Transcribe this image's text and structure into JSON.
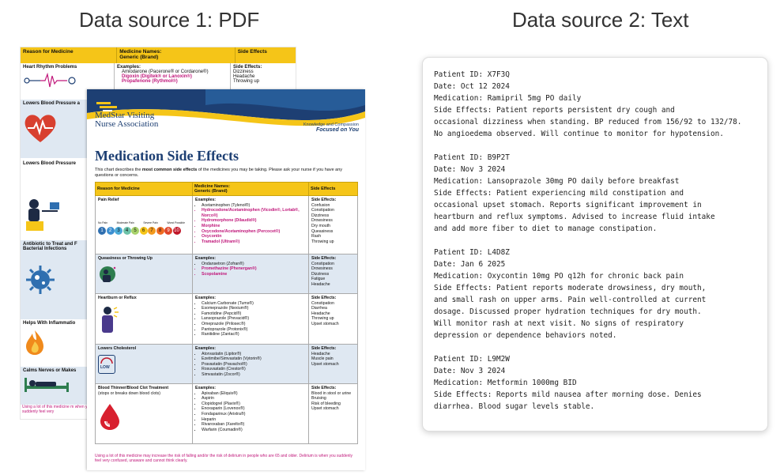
{
  "headings": {
    "left": "Data source 1: PDF",
    "right": "Data source 2: Text"
  },
  "pdf_back": {
    "header": [
      "Reason for Medicine",
      "Medicine Names:\nGeneric (Brand)",
      "Side Effects"
    ],
    "row1": {
      "reason": "Heart Rhythm Problems",
      "examples_label": "Examples:",
      "meds": [
        "Amiodarone (Pacerone® or Cordarone®)",
        "Digoxin (Digitek® or Lanoxin®)",
        "Propafenone (Rythmol®)"
      ],
      "side_label": "Side Effects:",
      "sides": [
        "Dizziness",
        "Headache",
        "Throwing up"
      ]
    },
    "left_labels": [
      "Lowers Blood Pressure a",
      "Lowers Blood Pressure",
      "Antibiotic to Treat and F Bacterial Infections",
      "Helps With Inflammatio",
      "Calms Nerves or Makes"
    ],
    "footnote": "Using a lot of this medicine m when you suddenly feel very"
  },
  "pdf_front": {
    "org_line1": "MedStar Visiting",
    "org_line2": "Nurse Association",
    "tagline": "Knowledge and Compassion",
    "tagline_bold": "Focused on You",
    "title": "Medication Side Effects",
    "intro_a": "This chart describes the ",
    "intro_b": "most common side effects",
    "intro_c": " of the medicines you may be taking. Please ask your nurse if you have any questions or concerns.",
    "header": [
      "Reason for Medicine",
      "Medicine Names:\nGeneric (Brand)",
      "Side Effects"
    ],
    "pain_scale_labels": [
      "No Pain",
      "Moderate Pain",
      "Severe Pain",
      "Worst Possible"
    ],
    "pain_scale_numbers": [
      "1",
      "2",
      "3",
      "4",
      "5",
      "6",
      "7",
      "8",
      "9",
      "10"
    ],
    "rows": [
      {
        "reason": "Pain Relief",
        "meds": [
          {
            "t": "Acetaminophen (Tylenol®)",
            "p": false
          },
          {
            "t": "Hydrocodone/Acetaminophen (Vicodin®, Lortab®, Norco®)",
            "p": true
          },
          {
            "t": "Hydromorphone (Dilaudid®)",
            "p": true
          },
          {
            "t": "Morphine",
            "p": true
          },
          {
            "t": "Oxycodone/Acetaminophen (Percocet®)",
            "p": true
          },
          {
            "t": "Oxycontin",
            "p": true
          },
          {
            "t": "Tramadol (Ultram®)",
            "p": true
          }
        ],
        "sides": [
          "Confusion",
          "Constipation",
          "Dizziness",
          "Drowsiness",
          "Dry mouth",
          "Queasiness",
          "Rash",
          "Throwing up"
        ]
      },
      {
        "reason": "Queasiness or Throwing Up",
        "meds": [
          {
            "t": "Ondansetron (Zofran®)",
            "p": false
          },
          {
            "t": "Promethazine (Phenergan®)",
            "p": true
          },
          {
            "t": "Scopolamine",
            "p": true
          }
        ],
        "sides": [
          "Constipation",
          "Drowsiness",
          "Dizziness",
          "Fatigue",
          "Headache"
        ]
      },
      {
        "reason": "Heartburn or Reflux",
        "meds": [
          {
            "t": "Calcium Carbonate (Tums®)",
            "p": false
          },
          {
            "t": "Esomeprazole (Nexium®)",
            "p": false
          },
          {
            "t": "Famotidine (Pepcid®)",
            "p": false
          },
          {
            "t": "Lansoprazole (Prevacid®)",
            "p": false
          },
          {
            "t": "Omeprazole (Prilosec®)",
            "p": false
          },
          {
            "t": "Pantoprazole (Protonix®)",
            "p": false
          },
          {
            "t": "Ranitidine (Zantac®)",
            "p": false
          }
        ],
        "sides": [
          "Constipation",
          "Diarrhea",
          "Headache",
          "Throwing up",
          "Upset stomach"
        ]
      },
      {
        "reason": "Lowers Cholesterol",
        "meds": [
          {
            "t": "Atorvastatin (Lipitor®)",
            "p": false
          },
          {
            "t": "Ezetimibe/Simvastatin (Vytorin®)",
            "p": false
          },
          {
            "t": "Pravastatin (Pravachol®)",
            "p": false
          },
          {
            "t": "Rosuvastatin (Crestor®)",
            "p": false
          },
          {
            "t": "Simvastatin (Zocor®)",
            "p": false
          }
        ],
        "sides": [
          "Headache",
          "Muscle pain",
          "Upset stomach"
        ]
      },
      {
        "reason": "Blood Thinner/Blood Clot Treatment",
        "reason_sub": "(stops or breaks down blood clots)",
        "meds": [
          {
            "t": "Apixaban (Eliquis®)",
            "p": false
          },
          {
            "t": "Aspirin",
            "p": false
          },
          {
            "t": "Clopidogrel (Plavix®)",
            "p": false
          },
          {
            "t": "Enoxaparin (Lovenox®)",
            "p": false
          },
          {
            "t": "Fondaparinux (Arixtra®)",
            "p": false
          },
          {
            "t": "Heparin",
            "p": false
          },
          {
            "t": "Rivaroxaban (Xarelto®)",
            "p": false
          },
          {
            "t": "Warfarin (Coumadin®)",
            "p": false
          }
        ],
        "sides": [
          "Blood in stool or urine",
          "Bruising",
          "Risk of bleeding",
          "Upset stomach"
        ]
      }
    ],
    "low_badge": "LOW",
    "footnote": "Using a lot of this medicine may increase the risk of falling and/or the risk of delirium in people who are 65 and older. Delirium is when you suddenly feel very confused, unaware and cannot think clearly."
  },
  "text_card": {
    "records": [
      "Patient ID: X7F3Q\nDate: Oct 12 2024\nMedication: Ramipril 5mg PO daily\nSide Effects: Patient reports persistent dry cough and\noccasional dizziness when standing. BP reduced from 156/92 to 132/78.\nNo angioedema observed. Will continue to monitor for hypotension.",
      "Patient ID: B9P2T\nDate: Nov 3 2024\nMedication: Lansoprazole 30mg PO daily before breakfast\nSide Effects: Patient experiencing mild constipation and\noccasional upset stomach. Reports significant improvement in\nheartburn and reflux symptoms. Advised to increase fluid intake\nand add more fiber to diet to manage constipation.",
      "Patient ID: L4D8Z\nDate: Jan 6 2025\nMedication: Oxycontin 10mg PO q12h for chronic back pain\nSide Effects: Patient reports moderate drowsiness, dry mouth,\nand small rash on upper arms. Pain well-controlled at current\ndosage. Discussed proper hydration techniques for dry mouth.\nWill monitor rash at next visit. No signs of respiratory\ndepression or dependence behaviors noted.",
      "Patient ID: L9M2W\nDate: Nov 3 2024\nMedication: Metformin 1000mg BID\nSide Effects: Reports mild nausea after morning dose. Denies\ndiarrhea. Blood sugar levels stable."
    ]
  }
}
